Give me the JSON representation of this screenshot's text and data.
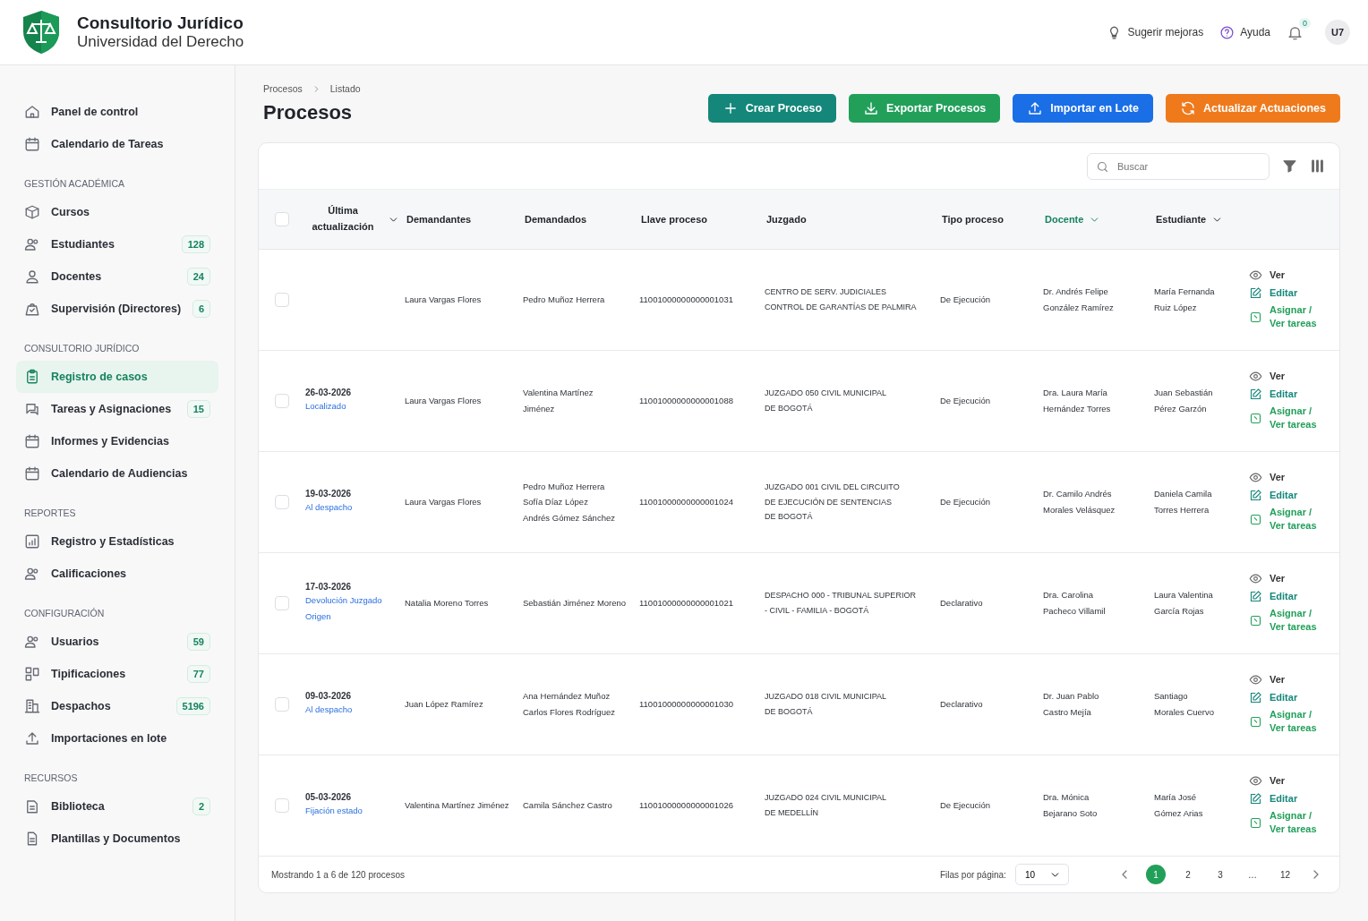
{
  "header": {
    "title": "Consultorio Jurídico",
    "subtitle": "Universidad del Derecho",
    "links": [
      {
        "label": "Sugerir mejoras",
        "kind": "bulb"
      },
      {
        "label": "Ayuda",
        "kind": "help"
      }
    ],
    "notifications": "0",
    "avatar": "U7"
  },
  "sidebar": {
    "sections": [
      {
        "items": [
          {
            "label": "Panel de control",
            "selected": false
          },
          {
            "label": "Calendario de Tareas",
            "selected": false
          }
        ]
      },
      {
        "title": "GESTIÓN ACADÉMICA",
        "items": [
          {
            "label": "Cursos",
            "selected": false
          },
          {
            "label": "Estudiantes",
            "count": "128",
            "selected": false
          },
          {
            "label": "Docentes",
            "count": "24",
            "selected": false
          },
          {
            "label": "Supervisión (Directores)",
            "count": "6",
            "selected": false
          }
        ]
      },
      {
        "title": "CONSULTORIO JURÍDICO",
        "items": [
          {
            "label": "Registro de casos",
            "selected": true
          },
          {
            "label": "Tareas y Asignaciones",
            "count": "15",
            "selected": false
          },
          {
            "label": "Informes y Evidencias",
            "selected": false
          },
          {
            "label": "Calendario de Audiencias",
            "selected": false
          }
        ]
      },
      {
        "title": "REPORTES",
        "items": [
          {
            "label": "Registro y Estadísticas",
            "selected": false
          },
          {
            "label": "Calificaciones",
            "selected": false
          }
        ]
      },
      {
        "title": "CONFIGURACIÓN",
        "items": [
          {
            "label": "Usuarios",
            "count": "59",
            "selected": false
          },
          {
            "label": "Tipificaciones",
            "count": "77",
            "selected": false
          },
          {
            "label": "Despachos",
            "count": "5196",
            "selected": false
          },
          {
            "label": "Importaciones en lote",
            "selected": false
          }
        ]
      },
      {
        "title": "RECURSOS",
        "items": [
          {
            "label": "Biblioteca",
            "count": "2",
            "selected": false
          },
          {
            "label": "Plantillas y Documentos",
            "selected": false
          }
        ]
      }
    ]
  },
  "breadcrumb": [
    "Procesos",
    "Listado"
  ],
  "page_title": "Procesos",
  "actions": [
    {
      "label": "Crear Proceso",
      "kind": "plus",
      "color": "#14877a"
    },
    {
      "label": "Exportar Procesos",
      "kind": "download",
      "color": "#22a05a"
    },
    {
      "label": "Importar en Lote",
      "kind": "upload",
      "color": "#1a6ee6"
    },
    {
      "label": "Actualizar Actuaciones",
      "kind": "refresh",
      "color": "#ef7a1c"
    }
  ],
  "search": {
    "placeholder": "Buscar"
  },
  "table": {
    "select_all_checked": false,
    "columns": [
      {
        "label": "Última actualización",
        "dropdown": true,
        "active": false
      },
      {
        "label": "Demandantes",
        "dropdown": false,
        "active": false
      },
      {
        "label": "Demandados",
        "dropdown": false,
        "active": false
      },
      {
        "label": "Llave proceso",
        "dropdown": false,
        "active": false
      },
      {
        "label": "Juzgado",
        "dropdown": false,
        "active": false
      },
      {
        "label": "Tipo proceso",
        "dropdown": false,
        "active": false
      },
      {
        "label": "Docente",
        "dropdown": true,
        "active": true
      },
      {
        "label": "Estudiante",
        "dropdown": true,
        "active": false
      }
    ],
    "rows": [
      {
        "checked": false,
        "demandantes": [
          "Laura Vargas Flores"
        ],
        "demandados": [
          "Pedro Muñoz Herrera"
        ],
        "llave": "11001000000000001031",
        "juzgado": [
          "CENTRO DE SERV. JUDICIALES",
          "CONTROL DE GARANTÍAS DE PALMIRA"
        ],
        "tipo": "De Ejecución",
        "docente": [
          "Dr. Andrés Felipe",
          "González Ramírez"
        ],
        "estudiante": [
          "María Fernanda",
          "Ruiz López"
        ],
        "actions": [
          {
            "label": "Ver",
            "kind": "view"
          },
          {
            "label": "Editar",
            "kind": "edit"
          },
          {
            "label": "Asignar / Ver tareas",
            "kind": "assign"
          }
        ]
      },
      {
        "checked": false,
        "date": "26-03-2026",
        "status": "Localizado",
        "demandantes": [
          "Laura Vargas Flores"
        ],
        "demandados": [
          "Valentina Martínez",
          "Jiménez"
        ],
        "llave": "11001000000000001088",
        "juzgado": [
          "JUZGADO 050 CIVIL MUNICIPAL",
          "DE BOGOTÁ"
        ],
        "tipo": "De Ejecución",
        "docente": [
          "Dra. Laura María",
          "Hernández Torres"
        ],
        "estudiante": [
          "Juan Sebastián",
          "Pérez Garzón"
        ],
        "actions": [
          {
            "label": "Ver",
            "kind": "view"
          },
          {
            "label": "Editar",
            "kind": "edit"
          },
          {
            "label": "Asignar / Ver tareas",
            "kind": "assign"
          }
        ]
      },
      {
        "checked": false,
        "date": "19-03-2026",
        "status": "Al despacho",
        "demandantes": [
          "Laura Vargas Flores"
        ],
        "demandados": [
          "Pedro Muñoz Herrera",
          "Sofía Díaz López",
          "Andrés Gómez Sánchez"
        ],
        "llave": "11001000000000001024",
        "juzgado": [
          "JUZGADO 001 CIVIL DEL CIRCUITO",
          "DE EJECUCIÓN DE SENTENCIAS",
          "DE BOGOTÁ"
        ],
        "tipo": "De Ejecución",
        "docente": [
          "Dr. Camilo Andrés",
          "Morales Velásquez"
        ],
        "estudiante": [
          "Daniela Camila",
          "Torres Herrera"
        ],
        "actions": [
          {
            "label": "Ver",
            "kind": "view"
          },
          {
            "label": "Editar",
            "kind": "edit"
          },
          {
            "label": "Asignar / Ver tareas",
            "kind": "assign"
          }
        ]
      },
      {
        "checked": false,
        "date": "17-03-2026",
        "status": "Devolución Juzgado Origen",
        "demandantes": [
          "Natalia Moreno Torres"
        ],
        "demandados": [
          "Sebastián Jiménez Moreno"
        ],
        "llave": "11001000000000001021",
        "juzgado": [
          "DESPACHO 000 - TRIBUNAL SUPERIOR",
          "- CIVIL - FAMILIA - BOGOTÁ"
        ],
        "tipo": "Declarativo",
        "docente": [
          "Dra. Carolina",
          "Pacheco Villamil"
        ],
        "estudiante": [
          "Laura Valentina",
          "García Rojas"
        ],
        "actions": [
          {
            "label": "Ver",
            "kind": "view"
          },
          {
            "label": "Editar",
            "kind": "edit"
          },
          {
            "label": "Asignar / Ver tareas",
            "kind": "assign"
          }
        ]
      },
      {
        "checked": false,
        "date": "09-03-2026",
        "status": "Al despacho",
        "demandantes": [
          "Juan López Ramírez"
        ],
        "demandados": [
          "Ana Hernández Muñoz",
          "Carlos Flores Rodríguez"
        ],
        "llave": "11001000000000001030",
        "juzgado": [
          "JUZGADO 018 CIVIL MUNICIPAL",
          "DE BOGOTÁ"
        ],
        "tipo": "Declarativo",
        "docente": [
          "Dr. Juan Pablo",
          "Castro Mejía"
        ],
        "estudiante": [
          "Santiago",
          "Morales Cuervo"
        ],
        "actions": [
          {
            "label": "Ver",
            "kind": "view"
          },
          {
            "label": "Editar",
            "kind": "edit"
          },
          {
            "label": "Asignar / Ver tareas",
            "kind": "assign"
          }
        ]
      },
      {
        "checked": false,
        "date": "05-03-2026",
        "status": "Fijación estado",
        "demandantes": [
          "Valentina Martínez Jiménez"
        ],
        "demandados": [
          "Camila Sánchez Castro"
        ],
        "llave": "11001000000000001026",
        "juzgado": [
          "JUZGADO 024 CIVIL MUNICIPAL",
          "DE MEDELLÍN"
        ],
        "tipo": "De Ejecución",
        "docente": [
          "Dra. Mónica",
          "Bejarano Soto"
        ],
        "estudiante": [
          "María José",
          "Gómez Arias"
        ],
        "actions": [
          {
            "label": "Ver",
            "kind": "view"
          },
          {
            "label": "Editar",
            "kind": "edit"
          },
          {
            "label": "Asignar / Ver tareas",
            "kind": "assign"
          }
        ]
      }
    ]
  },
  "footer": {
    "summary": "Mostrando 1 a 6 de 120 procesos",
    "rows_label": "Filas por página:",
    "rows_value": "10",
    "pages": [
      {
        "label": "1",
        "selected": true
      },
      {
        "label": "2",
        "selected": false
      },
      {
        "label": "3",
        "selected": false
      },
      {
        "label": "…",
        "selected": false
      },
      {
        "label": "12",
        "selected": false
      }
    ]
  }
}
